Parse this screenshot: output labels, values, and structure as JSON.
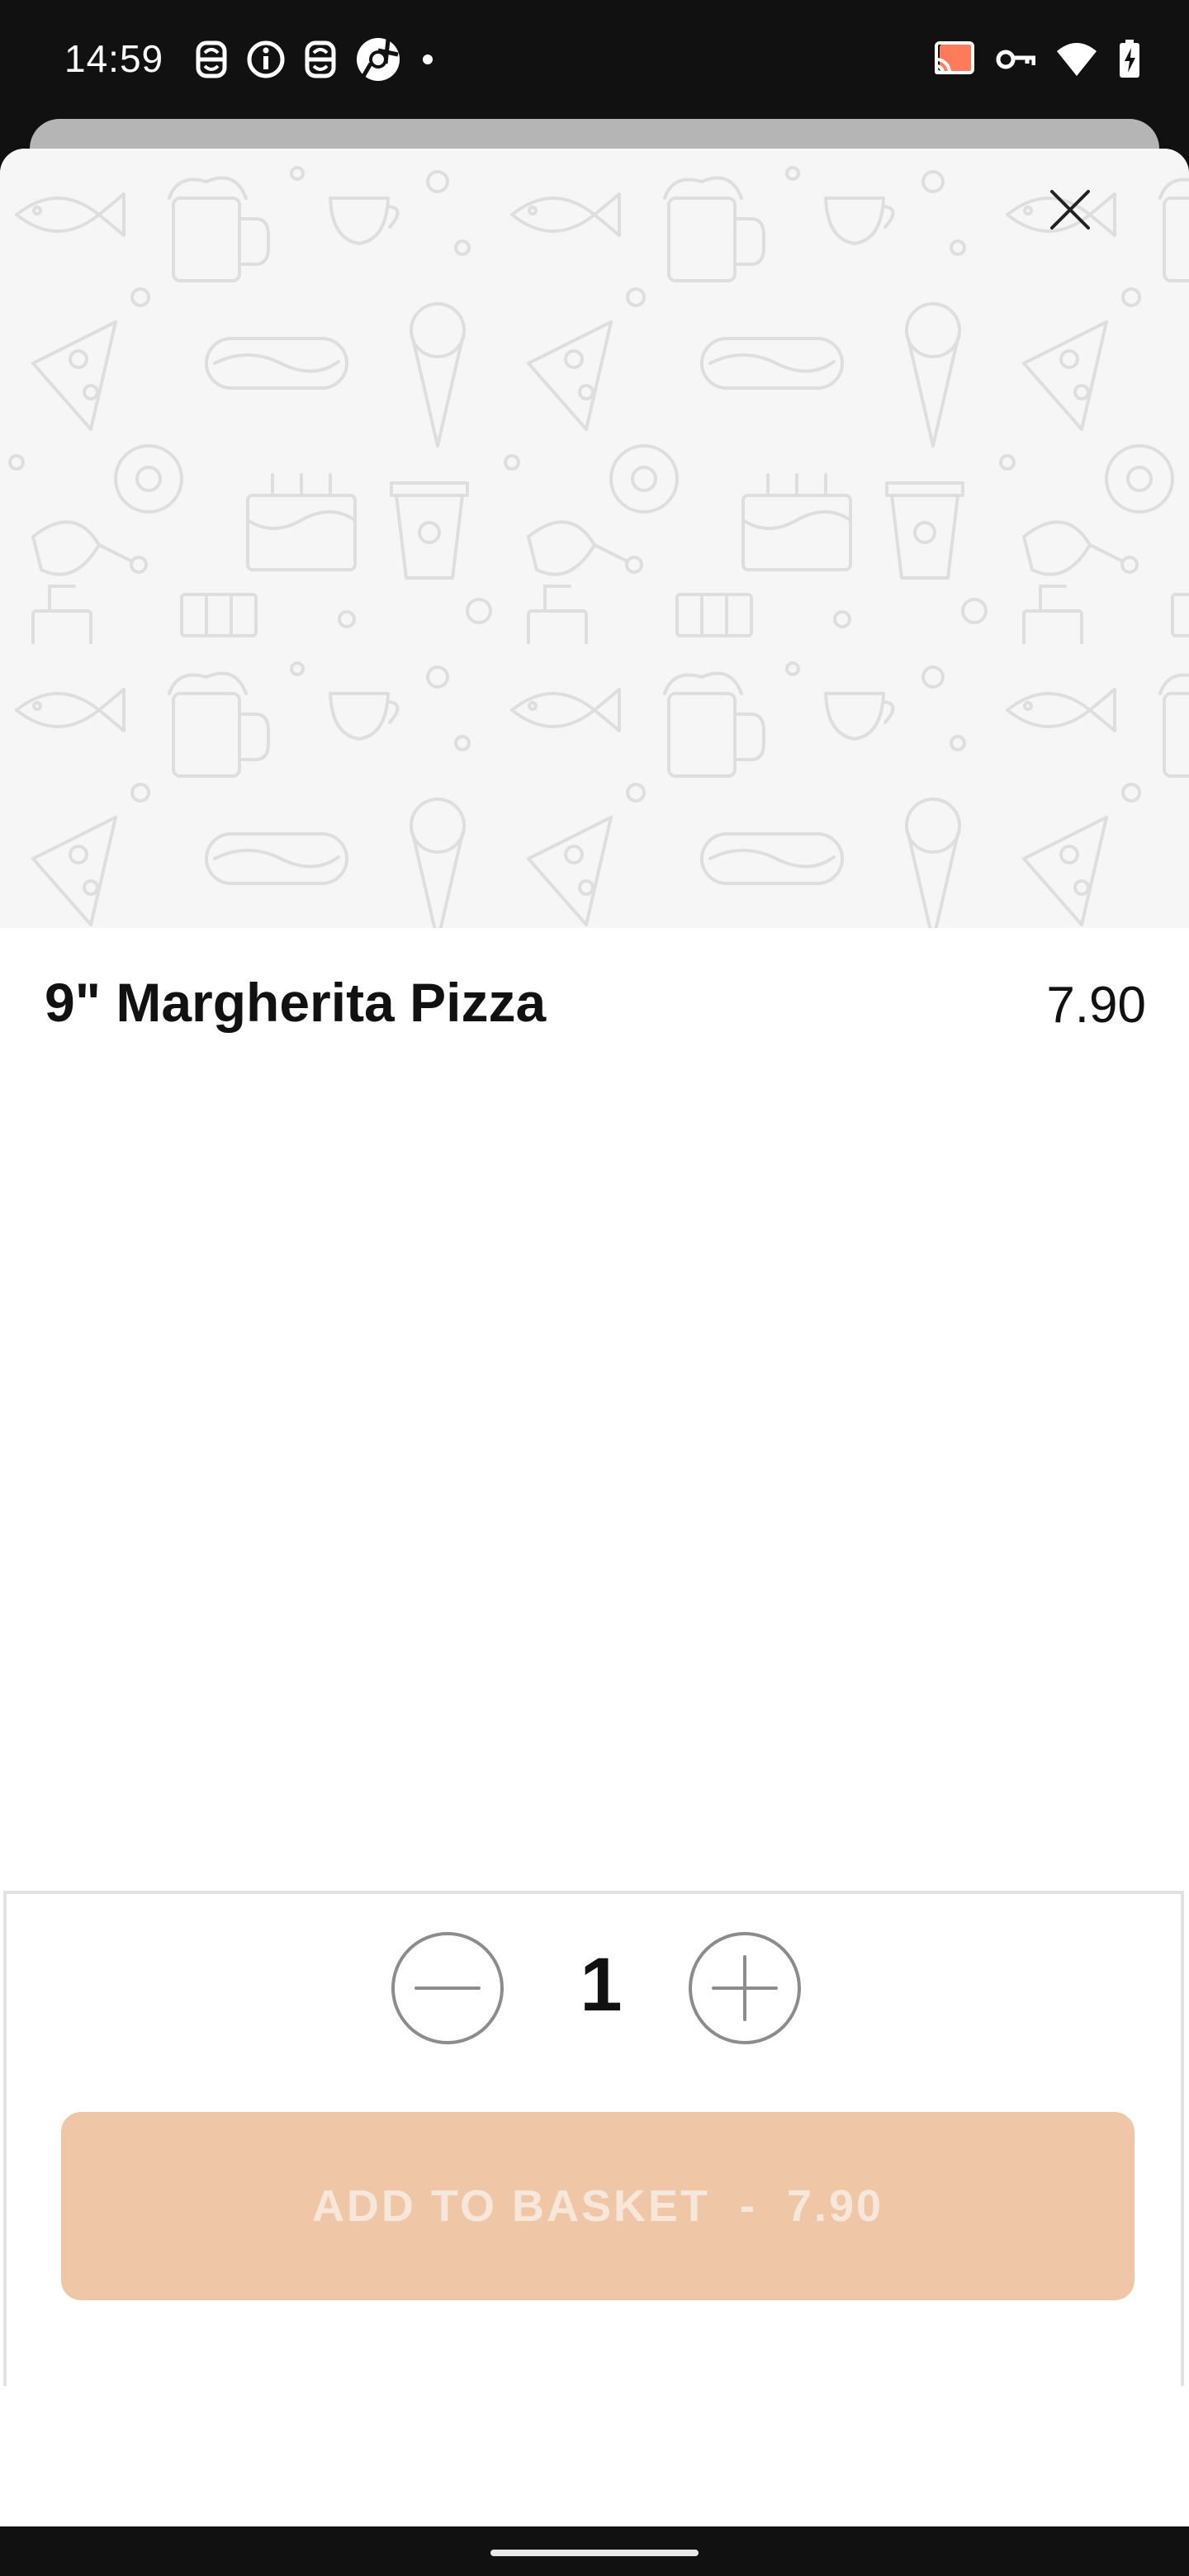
{
  "status_bar": {
    "time": "14:59",
    "left_icons": [
      "strikethrough-s-icon",
      "info-icon",
      "strikethrough-s-icon",
      "chromium-icon",
      "dot-icon"
    ],
    "right_icons": [
      "cast-icon",
      "vpn-key-icon",
      "wifi-icon",
      "battery-charging-icon"
    ],
    "cast_color": "#ff7b5a"
  },
  "item": {
    "title": "9\" Margherita Pizza",
    "price": "7.90"
  },
  "quantity": {
    "value": "1",
    "minus_icon": "minus-icon",
    "plus_icon": "plus-icon"
  },
  "add_button": {
    "label": "ADD TO BASKET  -  7.90",
    "background": "#efc7a6",
    "text_color": "#f7e7da"
  },
  "close_icon": "close-icon"
}
